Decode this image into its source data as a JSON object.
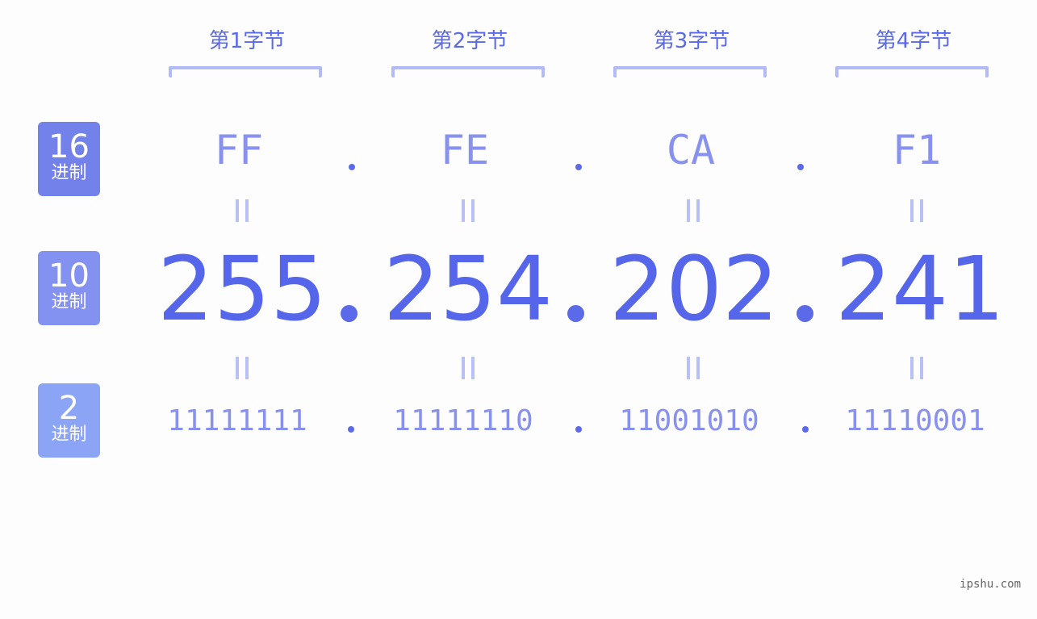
{
  "headers": [
    "第1字节",
    "第2字节",
    "第3字节",
    "第4字节"
  ],
  "badges": [
    {
      "num": "16",
      "label": "进制",
      "color": "#7381ea"
    },
    {
      "num": "10",
      "label": "进制",
      "color": "#8391f0"
    },
    {
      "num": "2",
      "label": "进制",
      "color": "#8ba4f6"
    }
  ],
  "hex": [
    "FF",
    "FE",
    "CA",
    "F1"
  ],
  "decimal": [
    "255",
    "254",
    "202",
    "241"
  ],
  "binary": [
    "11111111",
    "11111110",
    "11001010",
    "11110001"
  ],
  "equals_symbol": "=",
  "footer": "ipshu.com"
}
